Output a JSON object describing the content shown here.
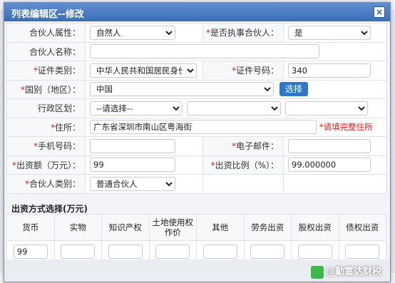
{
  "dialog": {
    "title": "列表编辑区--修改",
    "close_icon": "×"
  },
  "form": {
    "partner_attribute": {
      "label": "合伙人属性：",
      "value": "自然人"
    },
    "executive_partner": {
      "required": "*",
      "label": "是否执事合伙人：",
      "value": "是"
    },
    "partner_name": {
      "label": "合伙人名称：",
      "value": ""
    },
    "id_type": {
      "required": "*",
      "label": "证件类别：",
      "value": "中华人民共和国居民身份"
    },
    "id_number": {
      "required": "*",
      "label": "证件号码：",
      "value": "340"
    },
    "country": {
      "required": "*",
      "label": "国别（地区）：",
      "value": "中国",
      "button": "选择"
    },
    "district": {
      "label": "行政区划：",
      "value1": "--请选择--",
      "value2": "",
      "value3": ""
    },
    "address": {
      "required": "*",
      "label": "住所：",
      "value": "广东省深圳市南山区粤海街",
      "hint": "*请填完整住所"
    },
    "phone": {
      "required": "*",
      "label": "手机号码：",
      "value": ""
    },
    "email": {
      "required": "*",
      "label": "电子邮件：",
      "value": ""
    },
    "capital": {
      "required": "*",
      "label": "出资额（万元）：",
      "value": "99"
    },
    "ratio": {
      "required": "*",
      "label": "出资比例（%）：",
      "value": "99.000000"
    },
    "partner_type": {
      "required": "*",
      "label": "合伙人类别：",
      "value": "普通合伙人"
    }
  },
  "contribution": {
    "section_title": "出资方式选择(万元)",
    "columns": [
      "货币",
      "实物",
      "知识产权",
      "土地使用权作价",
      "其他",
      "劳务出资",
      "股权出资",
      "债权出资"
    ],
    "values": [
      "99",
      "",
      "",
      "",
      "",
      "",
      "",
      ""
    ]
  },
  "watermark": {
    "text": "@勤富达财税"
  }
}
